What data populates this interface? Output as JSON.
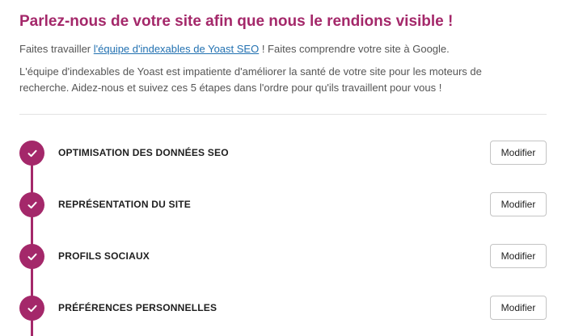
{
  "header": {
    "title": "Parlez-nous de votre site afin que nous le rendions visible !",
    "intro_prefix": "Faites travailler ",
    "intro_link": "l'équipe d'indexables de Yoast SEO",
    "intro_suffix": " ! Faites comprendre votre site à Google.",
    "description": "L'équipe d'indexables de Yoast est impatiente d'améliorer la santé de votre site pour les moteurs de recherche. Aidez-nous et suivez ces 5 étapes dans l'ordre pour qu'ils travaillent pour vous !"
  },
  "steps": [
    {
      "label": "OPTIMISATION DES DONNÉES SEO",
      "button": "Modifier",
      "status": "completed"
    },
    {
      "label": "REPRÉSENTATION DU SITE",
      "button": "Modifier",
      "status": "completed"
    },
    {
      "label": "PROFILS SOCIAUX",
      "button": "Modifier",
      "status": "completed"
    },
    {
      "label": "PRÉFÉRENCES PERSONNELLES",
      "button": "Modifier",
      "status": "completed"
    }
  ],
  "colors": {
    "accent": "#a4286a",
    "link": "#2271b1"
  },
  "icons": {
    "step_status": "checkmark-icon"
  }
}
